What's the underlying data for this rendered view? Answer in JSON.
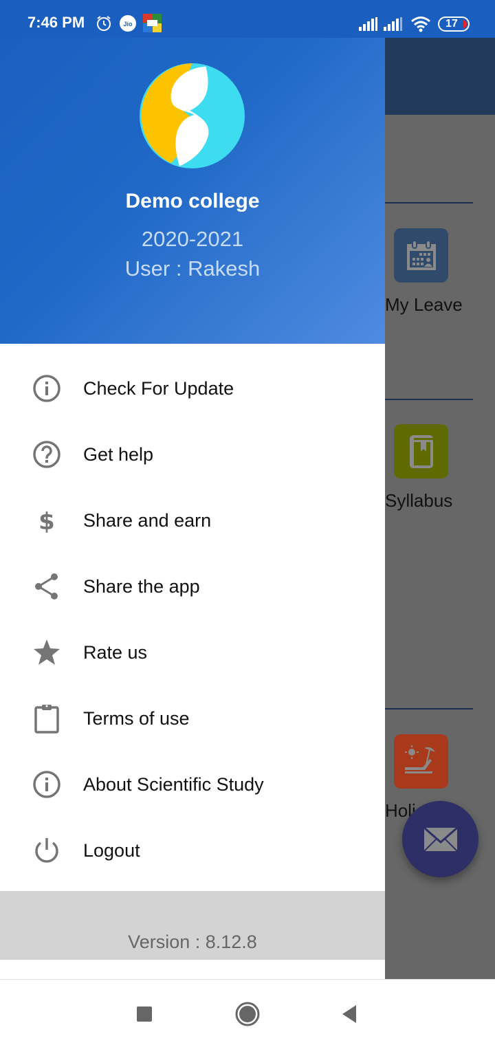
{
  "status_bar": {
    "time": "7:46 PM",
    "carrier_badge": "Jio",
    "battery_level": "17",
    "icons": [
      "alarm-icon",
      "jio-icon",
      "ludo-app-icon",
      "signal-icon",
      "signal-icon",
      "wifi-icon",
      "battery-icon"
    ]
  },
  "drawer": {
    "header": {
      "logo": "scientific-study-logo",
      "college_name": "Demo college",
      "session_year": "2020-2021",
      "user_line": "User : Rakesh"
    },
    "menu_items": [
      {
        "label": "Check For Update",
        "icon": "info-icon"
      },
      {
        "label": "Get help",
        "icon": "help-icon"
      },
      {
        "label": "Share and earn",
        "icon": "dollar-icon"
      },
      {
        "label": "Share the app",
        "icon": "share-icon"
      },
      {
        "label": "Rate us",
        "icon": "star-icon"
      },
      {
        "label": "Terms of use",
        "icon": "clipboard-icon"
      },
      {
        "label": "About Scientific Study",
        "icon": "info-icon"
      },
      {
        "label": "Logout",
        "icon": "power-icon"
      }
    ],
    "version": "Version : 8.12.8"
  },
  "background_app": {
    "tiles": [
      {
        "label": "My Leave",
        "icon": "calendar-icon",
        "color": "#2f4a6b"
      },
      {
        "label": "Syllabus",
        "icon": "book-icon",
        "color": "#5f6a00"
      },
      {
        "label": "Holi",
        "icon": "holiday-icon",
        "color": "#a8391a"
      }
    ],
    "fab_icon": "mail-icon"
  },
  "colors": {
    "header_blue": "#1a5fc0",
    "menu_icon_gray": "#757575",
    "fab": "#2e2f66"
  },
  "nav_bar": {
    "buttons": [
      "recents-button",
      "home-button",
      "back-button"
    ]
  }
}
